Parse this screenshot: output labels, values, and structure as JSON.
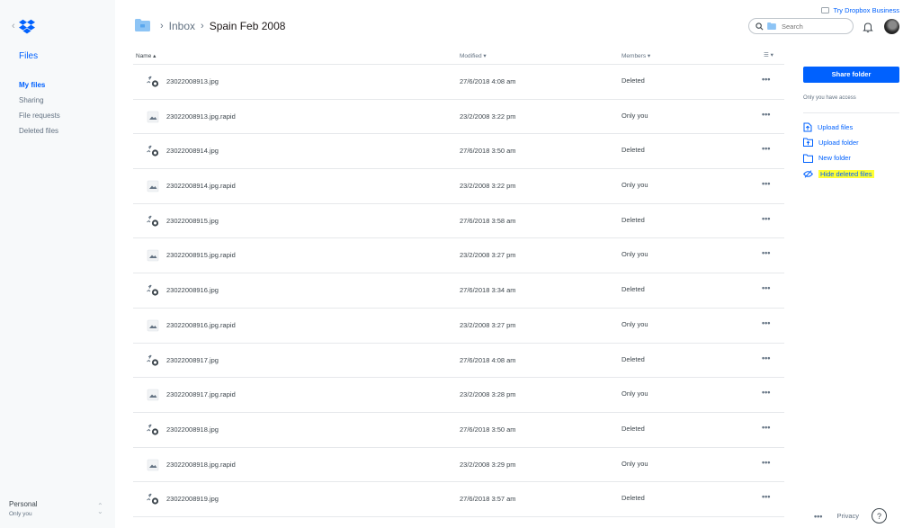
{
  "sidebar": {
    "back_glyph": "‹",
    "logo_icon": "dropbox-logo-icon",
    "section_title": "Files",
    "nav": [
      {
        "label": "My files",
        "active": true
      },
      {
        "label": "Sharing",
        "active": false
      },
      {
        "label": "File requests",
        "active": false
      },
      {
        "label": "Deleted files",
        "active": false
      }
    ],
    "account": {
      "name": "Personal",
      "sub": "Only you"
    }
  },
  "header": {
    "breadcrumb": [
      "Inbox",
      "Spain Feb 2008"
    ],
    "try_business": "Try Dropbox Business",
    "search_placeholder": "Search"
  },
  "table": {
    "columns": {
      "name": "Name ▴",
      "modified": "Modified ▾",
      "members": "Members ▾",
      "view": "☰ ▾"
    },
    "rows": [
      {
        "name": "23022008913.jpg",
        "modified": "27/6/2018 4:08 am",
        "members": "Deleted",
        "deleted": true
      },
      {
        "name": "23022008913.jpg.rapid",
        "modified": "23/2/2008 3:22 pm",
        "members": "Only you",
        "deleted": false
      },
      {
        "name": "23022008914.jpg",
        "modified": "27/6/2018 3:50 am",
        "members": "Deleted",
        "deleted": true
      },
      {
        "name": "23022008914.jpg.rapid",
        "modified": "23/2/2008 3:22 pm",
        "members": "Only you",
        "deleted": false
      },
      {
        "name": "23022008915.jpg",
        "modified": "27/6/2018 3:58 am",
        "members": "Deleted",
        "deleted": true
      },
      {
        "name": "23022008915.jpg.rapid",
        "modified": "23/2/2008 3:27 pm",
        "members": "Only you",
        "deleted": false
      },
      {
        "name": "23022008916.jpg",
        "modified": "27/6/2018 3:34 am",
        "members": "Deleted",
        "deleted": true
      },
      {
        "name": "23022008916.jpg.rapid",
        "modified": "23/2/2008 3:27 pm",
        "members": "Only you",
        "deleted": false
      },
      {
        "name": "23022008917.jpg",
        "modified": "27/6/2018 4:08 am",
        "members": "Deleted",
        "deleted": true
      },
      {
        "name": "23022008917.jpg.rapid",
        "modified": "23/2/2008 3:28 pm",
        "members": "Only you",
        "deleted": false
      },
      {
        "name": "23022008918.jpg",
        "modified": "27/6/2018 3:50 am",
        "members": "Deleted",
        "deleted": true
      },
      {
        "name": "23022008918.jpg.rapid",
        "modified": "23/2/2008 3:29 pm",
        "members": "Only you",
        "deleted": false
      },
      {
        "name": "23022008919.jpg",
        "modified": "27/6/2018 3:57 am",
        "members": "Deleted",
        "deleted": true
      }
    ],
    "more_glyph": "•••"
  },
  "panel": {
    "share_button": "Share folder",
    "access_note": "Only you have access",
    "actions": [
      {
        "label": "Upload files",
        "icon": "upload-file-icon"
      },
      {
        "label": "Upload folder",
        "icon": "upload-folder-icon"
      },
      {
        "label": "New folder",
        "icon": "new-folder-icon"
      },
      {
        "label": "Hide deleted files",
        "icon": "hide-eye-icon",
        "highlighted": true
      }
    ]
  },
  "footer": {
    "more": "•••",
    "privacy": "Privacy",
    "help": "?"
  },
  "colors": {
    "accent": "#0061fe",
    "highlight": "#ffff32",
    "sidebar_bg": "#f7f9fa"
  }
}
